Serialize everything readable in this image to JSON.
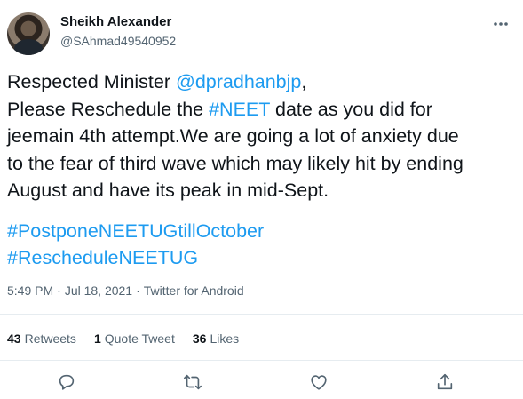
{
  "tweet": {
    "author": {
      "name": "Sheikh Alexander",
      "handle": "@SAhmad49540952"
    },
    "text": {
      "intro": "Respected Minister ",
      "mention": "@dpradhanbjp",
      "after_mention": ",\nPlease Reschedule the ",
      "hashtag_inline": "#NEET",
      "body": " date as you did for\njeemain 4th attempt.We are going a lot of anxiety due\nto the fear of third wave which may likely hit by ending\nAugust and have its peak in mid-Sept."
    },
    "hashtags": [
      "#PostponeNEETUGtillOctober",
      "#RescheduleNEETUG"
    ],
    "time": "5:49 PM",
    "separator": "·",
    "date": "Jul 18, 2021",
    "source": "Twitter for Android",
    "stats": {
      "retweets": {
        "count": "43",
        "label": "Retweets"
      },
      "quotes": {
        "count": "1",
        "label": "Quote Tweet"
      },
      "likes": {
        "count": "36",
        "label": "Likes"
      }
    }
  },
  "icons": {
    "more": "more-dots-icon",
    "reply": "reply-icon",
    "retweet": "retweet-icon",
    "like": "heart-icon",
    "share": "share-icon"
  },
  "colors": {
    "link": "#1d9bf0",
    "text": "#0f1419",
    "muted": "#536471",
    "divider": "#e6ecf0"
  }
}
